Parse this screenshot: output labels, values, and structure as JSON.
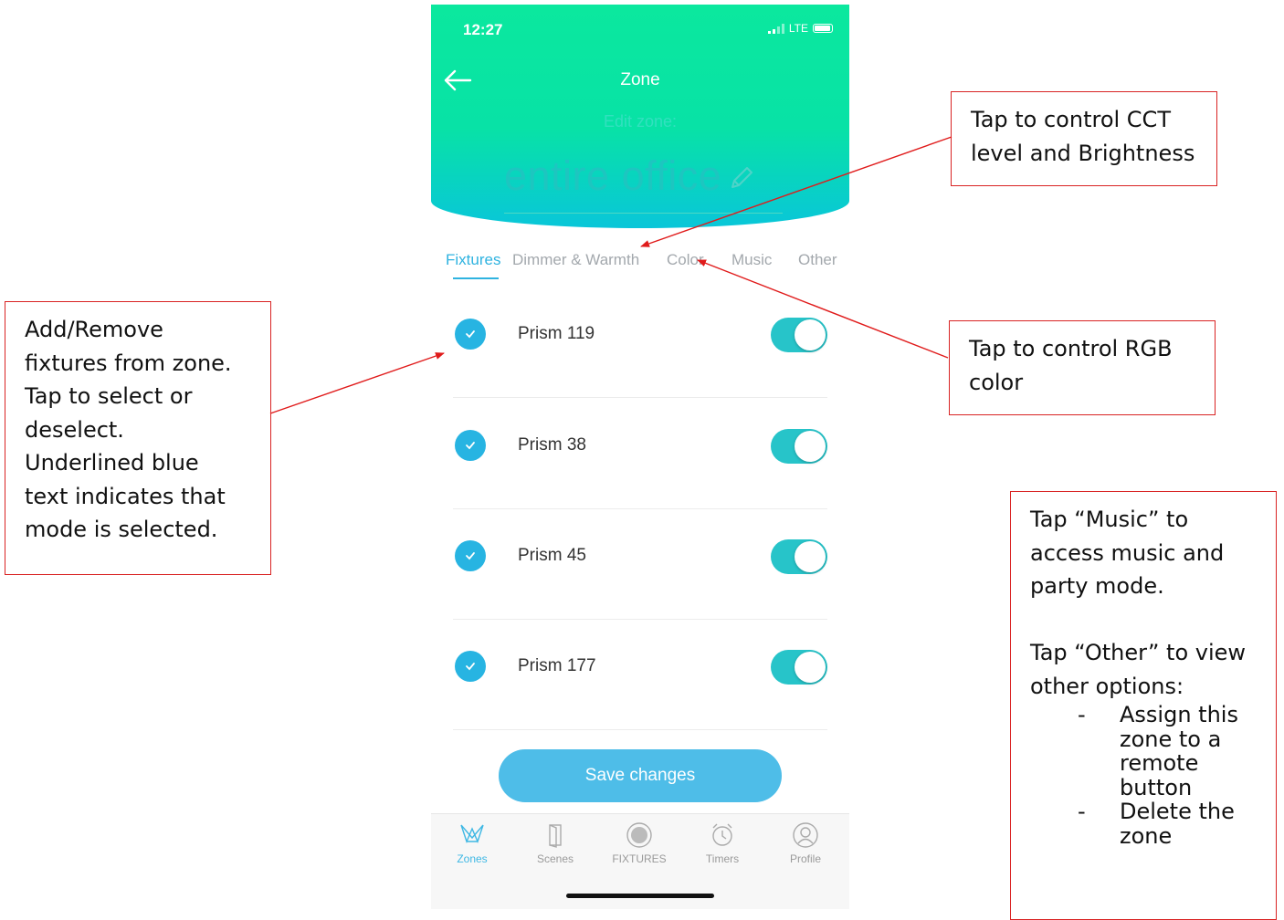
{
  "status_bar": {
    "time": "12:27",
    "network": "LTE"
  },
  "header": {
    "title": "Zone",
    "edit_label": "Edit zone:",
    "zone_name": "entire office"
  },
  "tabs": [
    {
      "label": "Fixtures",
      "active": true
    },
    {
      "label": "Dimmer & Warmth",
      "active": false
    },
    {
      "label": "Color",
      "active": false
    },
    {
      "label": "Music",
      "active": false
    },
    {
      "label": "Other",
      "active": false
    }
  ],
  "fixtures": [
    {
      "name": "Prism 119",
      "checked": true,
      "enabled": true
    },
    {
      "name": "Prism 38",
      "checked": true,
      "enabled": true
    },
    {
      "name": "Prism 45",
      "checked": true,
      "enabled": true
    },
    {
      "name": "Prism 177",
      "checked": true,
      "enabled": true
    }
  ],
  "save_button": "Save changes",
  "bottom_nav": [
    {
      "label": "Zones",
      "icon": "zones-icon",
      "active": true
    },
    {
      "label": "Scenes",
      "icon": "door-icon",
      "active": false
    },
    {
      "label": "FIXTURES",
      "icon": "fixture-disc-icon",
      "active": false
    },
    {
      "label": "Timers",
      "icon": "alarm-clock-icon",
      "active": false
    },
    {
      "label": "Profile",
      "icon": "profile-icon",
      "active": false
    }
  ],
  "annotations": {
    "cct": [
      "Tap to control CCT",
      "level and Brightness"
    ],
    "fixtures_help": [
      "Add/Remove",
      "fixtures from zone.",
      "Tap to select or",
      "deselect.",
      "Underlined blue",
      "text indicates that",
      "mode is selected."
    ],
    "rgb": [
      "Tap to control RGB",
      "color"
    ],
    "music_other": {
      "music_lines": [
        "Tap “Music” to",
        "access music and",
        "party mode."
      ],
      "other_lines": [
        "Tap “Other” to view",
        "other options:"
      ],
      "bullets": [
        " Assign this zone to a remote button",
        "Delete the zone"
      ]
    }
  },
  "colors": {
    "header_green": "#0be89e",
    "accent_blue": "#2fb3e0",
    "toggle_teal": "#27c4c9",
    "callout_red": "#d92323"
  }
}
